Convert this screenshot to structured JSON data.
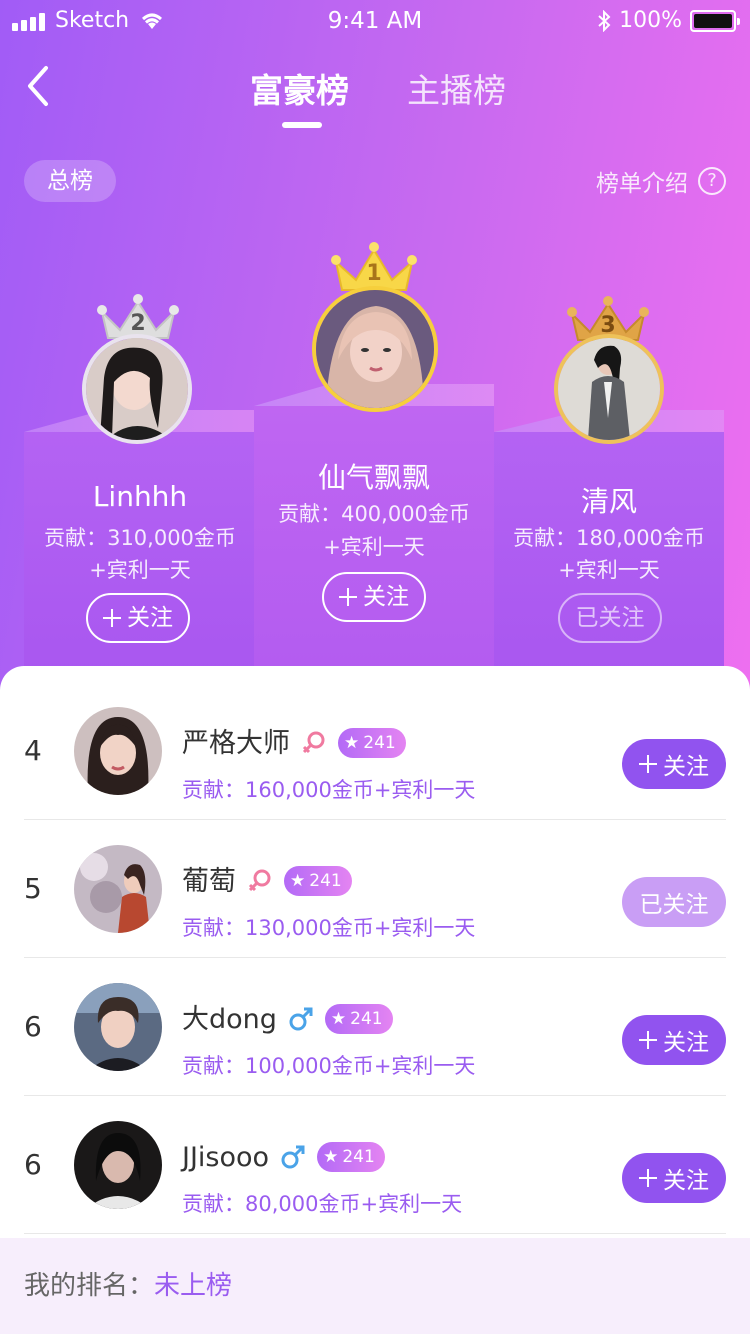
{
  "status_bar": {
    "carrier": "Sketch",
    "time": "9:41 AM",
    "battery": "100%"
  },
  "nav": {
    "tab_active": "富豪榜",
    "tab_inactive": "主播榜"
  },
  "filter": {
    "label": "总榜"
  },
  "rules": {
    "label": "榜单介绍",
    "icon": "?"
  },
  "podium": [
    {
      "rank": "1",
      "name": "仙气飘飘",
      "contribution": "贡献：400,000金币",
      "reward": "+宾利一天",
      "button": "关注",
      "followed": false
    },
    {
      "rank": "2",
      "name": "Linhhh",
      "contribution": "贡献：310,000金币",
      "reward": "+宾利一天",
      "button": "关注",
      "followed": false
    },
    {
      "rank": "3",
      "name": "清风",
      "contribution": "贡献：180,000金币",
      "reward": "+宾利一天",
      "button": "已关注",
      "followed": true
    }
  ],
  "list": [
    {
      "rank": "4",
      "name": "严格大师",
      "gender": "female",
      "level": "241",
      "contribution": "贡献：160,000金币+宾利一天",
      "button": "关注",
      "followed": false
    },
    {
      "rank": "5",
      "name": "葡萄",
      "gender": "female",
      "level": "241",
      "contribution": "贡献：130,000金币+宾利一天",
      "button": "已关注",
      "followed": true
    },
    {
      "rank": "6",
      "name": "大dong",
      "gender": "male",
      "level": "241",
      "contribution": "贡献：100,000金币+宾利一天",
      "button": "关注",
      "followed": false
    },
    {
      "rank": "6",
      "name": "JJisooo",
      "gender": "male",
      "level": "241",
      "contribution": "贡献：80,000金币+宾利一天",
      "button": "关注",
      "followed": false
    }
  ],
  "my_rank": {
    "label": "我的排名：",
    "value": "未上榜"
  },
  "colors": {
    "accent": "#9153ef",
    "accent_light": "#c99ef5",
    "hero_start": "#a15cf6",
    "hero_end": "#ee6ff0",
    "female": "#f07aa0",
    "male": "#4aa3e8",
    "gold": "#f6cf3c",
    "silver": "#d8d8d8",
    "bronze": "#d89a3a"
  }
}
